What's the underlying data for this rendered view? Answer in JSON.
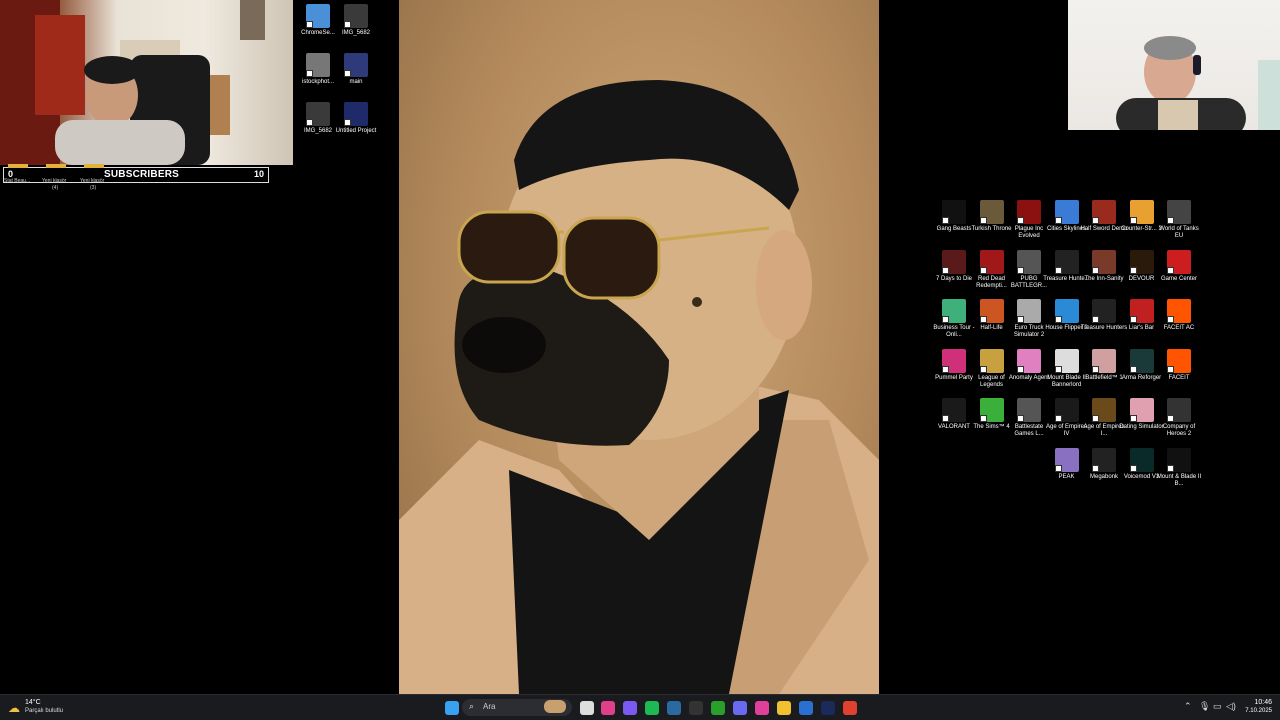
{
  "overlay": {
    "subscribers_label": "SUBSCRIBERS",
    "count_start": "0",
    "count_goal": "10",
    "goal_labels": [
      {
        "name": "Stat Beau...",
        "count": ""
      },
      {
        "name": "Yeni klasör",
        "count": "(4)"
      },
      {
        "name": "Yeni klasör",
        "count": "(3)"
      }
    ]
  },
  "desktop_left": [
    {
      "label": "ChromeSe...",
      "icon": "chrome-setup-icon",
      "color": "#4a90d9"
    },
    {
      "label": "IMG_5682",
      "icon": "image-file-icon",
      "color": "#3a3a3a"
    },
    {
      "label": "istockphot...",
      "icon": "image-file-icon",
      "color": "#777777"
    },
    {
      "label": "main",
      "icon": "image-file-icon",
      "color": "#2e3a7a"
    },
    {
      "label": "IMG_5682",
      "icon": "image-file-icon",
      "color": "#3a3a3a"
    },
    {
      "label": "Untitled Project",
      "icon": "after-effects-icon",
      "color": "#1f2a6b"
    }
  ],
  "desktop_right": [
    {
      "label": "Gang Beasts",
      "icon": "gang-beasts-icon",
      "color": "#111111"
    },
    {
      "label": "Turkish Throne",
      "icon": "turkish-throne-icon",
      "color": "#6b5a3a"
    },
    {
      "label": "Plague Inc Evolved",
      "icon": "plague-inc-icon",
      "color": "#8b1010"
    },
    {
      "label": "Cities Skylines",
      "icon": "cities-skylines-icon",
      "color": "#3a7bd5"
    },
    {
      "label": "Half Sword Demo",
      "icon": "half-sword-icon",
      "color": "#9a2a1e"
    },
    {
      "label": "Counter-Str... 2",
      "icon": "counter-strike-icon",
      "color": "#e8a030"
    },
    {
      "label": "World of Tanks EU",
      "icon": "world-of-tanks-icon",
      "color": "#444444"
    },
    {
      "label": "7 Days to Die",
      "icon": "7-days-to-die-icon",
      "color": "#5a1a1a"
    },
    {
      "label": "Red Dead Redempti...",
      "icon": "red-dead-icon",
      "color": "#a01818"
    },
    {
      "label": "PUBG BATTLEGR...",
      "icon": "pubg-icon",
      "color": "#555555"
    },
    {
      "label": "Treasure Hunte...",
      "icon": "treasure-hunter-icon",
      "color": "#222222"
    },
    {
      "label": "The Inn-Sanity",
      "icon": "inn-sanity-icon",
      "color": "#7a3a2a"
    },
    {
      "label": "DEVOUR",
      "icon": "devour-icon",
      "color": "#2a1a0a"
    },
    {
      "label": "Game Center",
      "icon": "game-center-icon",
      "color": "#cc1e1e"
    },
    {
      "label": "Business Tour - Onli...",
      "icon": "business-tour-icon",
      "color": "#3fb07a"
    },
    {
      "label": "Half-Life",
      "icon": "half-life-icon",
      "color": "#cc5522"
    },
    {
      "label": "Euro Truck Simulator 2",
      "icon": "euro-truck-icon",
      "color": "#aaaaaa"
    },
    {
      "label": "House Flipper 2",
      "icon": "house-flipper-icon",
      "color": "#2a8ad5"
    },
    {
      "label": "Treasure Hunters",
      "icon": "treasure-hunter-icon",
      "color": "#222222"
    },
    {
      "label": "Liar's Bar",
      "icon": "liars-bar-icon",
      "color": "#c02020"
    },
    {
      "label": "FACEIT AC",
      "icon": "faceit-ac-icon",
      "color": "#ff5500"
    },
    {
      "label": "Pummel Party",
      "icon": "pummel-party-icon",
      "color": "#d0307a"
    },
    {
      "label": "League of Legends",
      "icon": "league-of-legends-icon",
      "color": "#c8a040"
    },
    {
      "label": "Anomaly Agent",
      "icon": "anomaly-agent-icon",
      "color": "#e080c0"
    },
    {
      "label": "Mount Blade II Bannerlord",
      "icon": "bannerlord-icon",
      "color": "#dddddd"
    },
    {
      "label": "Battlefield™ 1",
      "icon": "battlefield-icon",
      "color": "#d0a0a0"
    },
    {
      "label": "Arma Reforger",
      "icon": "arma-reforger-icon",
      "color": "#1a3a3a"
    },
    {
      "label": "FACEIT",
      "icon": "faceit-icon",
      "color": "#ff5500"
    },
    {
      "label": "VALORANT",
      "icon": "valorant-icon",
      "color": "#1a1a1a"
    },
    {
      "label": "The Sims™ 4",
      "icon": "sims-icon",
      "color": "#3ab03a"
    },
    {
      "label": "Battlestate Games L...",
      "icon": "battlestate-icon",
      "color": "#555555"
    },
    {
      "label": "Age of Empires IV",
      "icon": "age-of-empires-icon",
      "color": "#1a1a1a"
    },
    {
      "label": "Age of Empires I...",
      "icon": "age-of-empires-icon",
      "color": "#6a4a1a"
    },
    {
      "label": "Dating Simulator",
      "icon": "dating-simulator-icon",
      "color": "#e0a0b0"
    },
    {
      "label": "Company of Heroes 2",
      "icon": "company-of-heroes-icon",
      "color": "#333333"
    },
    {
      "label": "PEAK",
      "icon": "peak-icon",
      "color": "#8a70c0"
    },
    {
      "label": "Megabonk",
      "icon": "megabonk-icon",
      "color": "#222222"
    },
    {
      "label": "Voicemod V3",
      "icon": "voicemod-icon",
      "color": "#0a2a2a"
    },
    {
      "label": "Mount & Blade II B...",
      "icon": "bannerlord-icon",
      "color": "#111111"
    }
  ],
  "taskbar": {
    "weather_temp": "14°C",
    "weather_desc": "Parçalı bulutlu",
    "search_placeholder": "Ara",
    "time": "10:46",
    "date": "7.10.2025",
    "apps": [
      {
        "icon": "windows-start-icon",
        "color": "#3aa0f0"
      },
      {
        "icon": "task-view-icon",
        "color": "#dddddd"
      },
      {
        "icon": "stream-app-icon",
        "color": "#e0408a"
      },
      {
        "icon": "messenger-icon",
        "color": "#7a5af0"
      },
      {
        "icon": "spotify-icon",
        "color": "#1db954"
      },
      {
        "icon": "steam-icon",
        "color": "#2a6aa0"
      },
      {
        "icon": "epic-games-icon",
        "color": "#333333"
      },
      {
        "icon": "xbox-icon",
        "color": "#2aa02a"
      },
      {
        "icon": "teams-icon",
        "color": "#6a6af0"
      },
      {
        "icon": "instagram-icon",
        "color": "#e0409a"
      },
      {
        "icon": "file-explorer-icon",
        "color": "#f0c030"
      },
      {
        "icon": "calendar-icon",
        "color": "#2a70d0"
      },
      {
        "icon": "photoshop-icon",
        "color": "#1a2a5a"
      },
      {
        "icon": "chrome-icon",
        "color": "#e04030"
      }
    ]
  }
}
